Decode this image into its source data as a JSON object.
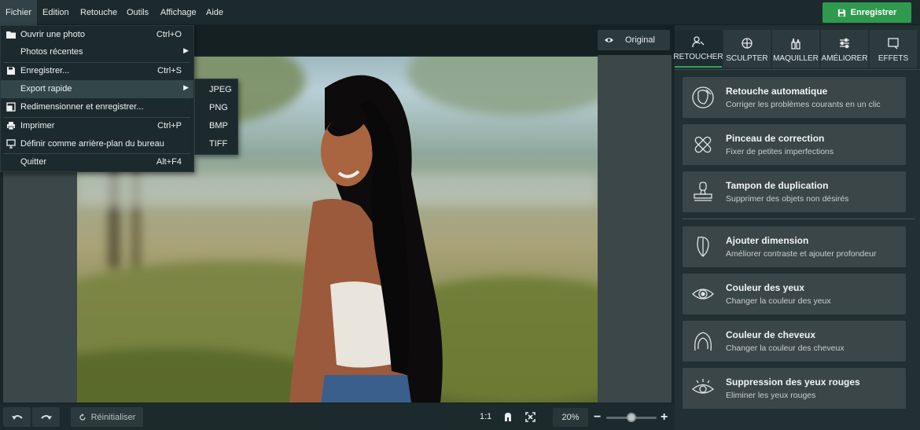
{
  "menubar": {
    "items": [
      "Fichier",
      "Edition",
      "Retouche",
      "Outils",
      "Affichage",
      "Aide"
    ],
    "save_label": "Enregistrer",
    "save_color": "#2f9a4e"
  },
  "file_menu": {
    "items": [
      {
        "label": "Ouvrir une photo",
        "shortcut": "Ctrl+O",
        "icon": "folder-icon"
      },
      {
        "label": "Photos récentes",
        "shortcut": "",
        "icon": ""
      },
      {
        "label": "Enregistrer...",
        "shortcut": "Ctrl+S",
        "icon": "floppy-icon"
      },
      {
        "label": "Export rapide",
        "shortcut": "",
        "icon": ""
      },
      {
        "label": "Redimensionner et enregistrer...",
        "shortcut": "",
        "icon": "resize-icon"
      },
      {
        "label": "Imprimer",
        "shortcut": "Ctrl+P",
        "icon": "printer-icon"
      },
      {
        "label": "Définir comme arrière-plan du bureau",
        "shortcut": "",
        "icon": "monitor-icon"
      },
      {
        "label": "Quitter",
        "shortcut": "Alt+F4",
        "icon": ""
      }
    ]
  },
  "export_submenu": {
    "items": [
      "JPEG",
      "PNG",
      "BMP",
      "TIFF"
    ]
  },
  "canvas": {
    "original_label": "Original"
  },
  "bottombar": {
    "reset_label": "Réinitialiser",
    "ratio_label": "1:1",
    "zoom_value": "20%",
    "zoom_level": 0.45
  },
  "panel": {
    "accent": "#2fa358",
    "tabs": [
      {
        "label": "RETOUCHER",
        "icon": "person-brush-icon"
      },
      {
        "label": "SCULPTER",
        "icon": "sculpt-icon"
      },
      {
        "label": "MAQUILLER",
        "icon": "makeup-icon"
      },
      {
        "label": "AMÉLIORER",
        "icon": "sliders-icon"
      },
      {
        "label": "EFFETS",
        "icon": "effects-icon"
      }
    ],
    "tools": [
      {
        "title": "Retouche automatique",
        "desc": "Corriger les problèmes courants en un clic",
        "icon": "auto-retouch-icon"
      },
      {
        "title": "Pinceau de correction",
        "desc": "Fixer de petites imperfections",
        "icon": "bandage-icon"
      },
      {
        "title": "Tampon de duplication",
        "desc": "Supprimer des objets non désirés",
        "icon": "stamp-icon"
      },
      {
        "title": "Ajouter dimension",
        "desc": "Améliorer contraste et ajouter profondeur",
        "icon": "face-dimension-icon"
      },
      {
        "title": "Couleur des yeux",
        "desc": "Changer la couleur des yeux",
        "icon": "eye-color-icon"
      },
      {
        "title": "Couleur de cheveux",
        "desc": "Changer la couleur des cheveux",
        "icon": "hair-icon"
      },
      {
        "title": "Suppression des yeux rouges",
        "desc": "Eliminer les yeux rouges",
        "icon": "red-eye-icon"
      }
    ]
  }
}
